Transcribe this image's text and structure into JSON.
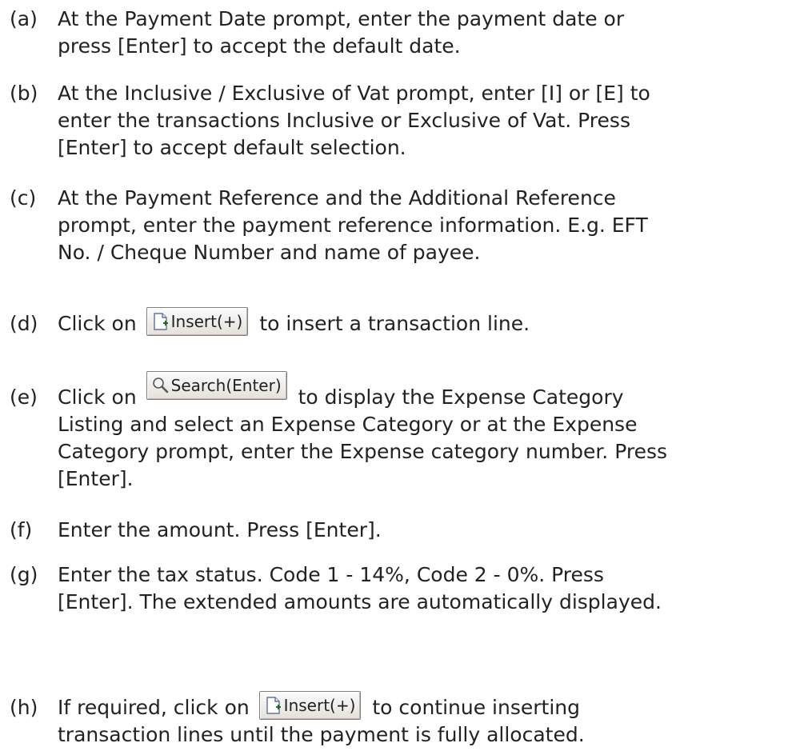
{
  "steps": [
    {
      "marker": "(a)",
      "lines": [
        "At the Payment Date prompt, enter the payment date or",
        "press [Enter] to accept the default date."
      ]
    },
    {
      "marker": "(b)",
      "lines": [
        "At the Inclusive / Exclusive of Vat prompt, enter [I] or [E] to",
        "enter the transactions Inclusive or Exclusive of Vat. Press",
        "[Enter] to accept default selection."
      ]
    },
    {
      "marker": "(c)",
      "lines": [
        "At the Payment Reference and the Additional Reference",
        "prompt, enter the payment reference information. E.g. EFT",
        "No. / Cheque Number and name of payee."
      ]
    },
    {
      "marker": "(d)",
      "before": "Click on",
      "button": "Insert(+)",
      "after": "to insert a transaction line."
    },
    {
      "marker": "(e)",
      "before": "Click on",
      "button": "Search(Enter)",
      "after": "to display the Expense Category",
      "lines": [
        "Listing and select an Expense Category or at the Expense",
        "Category prompt, enter the Expense category number. Press",
        "[Enter]."
      ]
    },
    {
      "marker": "(f)",
      "lines": [
        "Enter the amount. Press [Enter]."
      ]
    },
    {
      "marker": "(g)",
      "lines": [
        "Enter the tax status. Code 1 - 14%, Code 2 - 0%. Press",
        "[Enter]. The extended amounts are automatically displayed."
      ]
    },
    {
      "marker": "(h)",
      "before": "If required, click on",
      "button": "Insert(+)",
      "after": "to continue inserting",
      "lines": [
        "transaction lines until the payment is fully allocated."
      ]
    }
  ]
}
